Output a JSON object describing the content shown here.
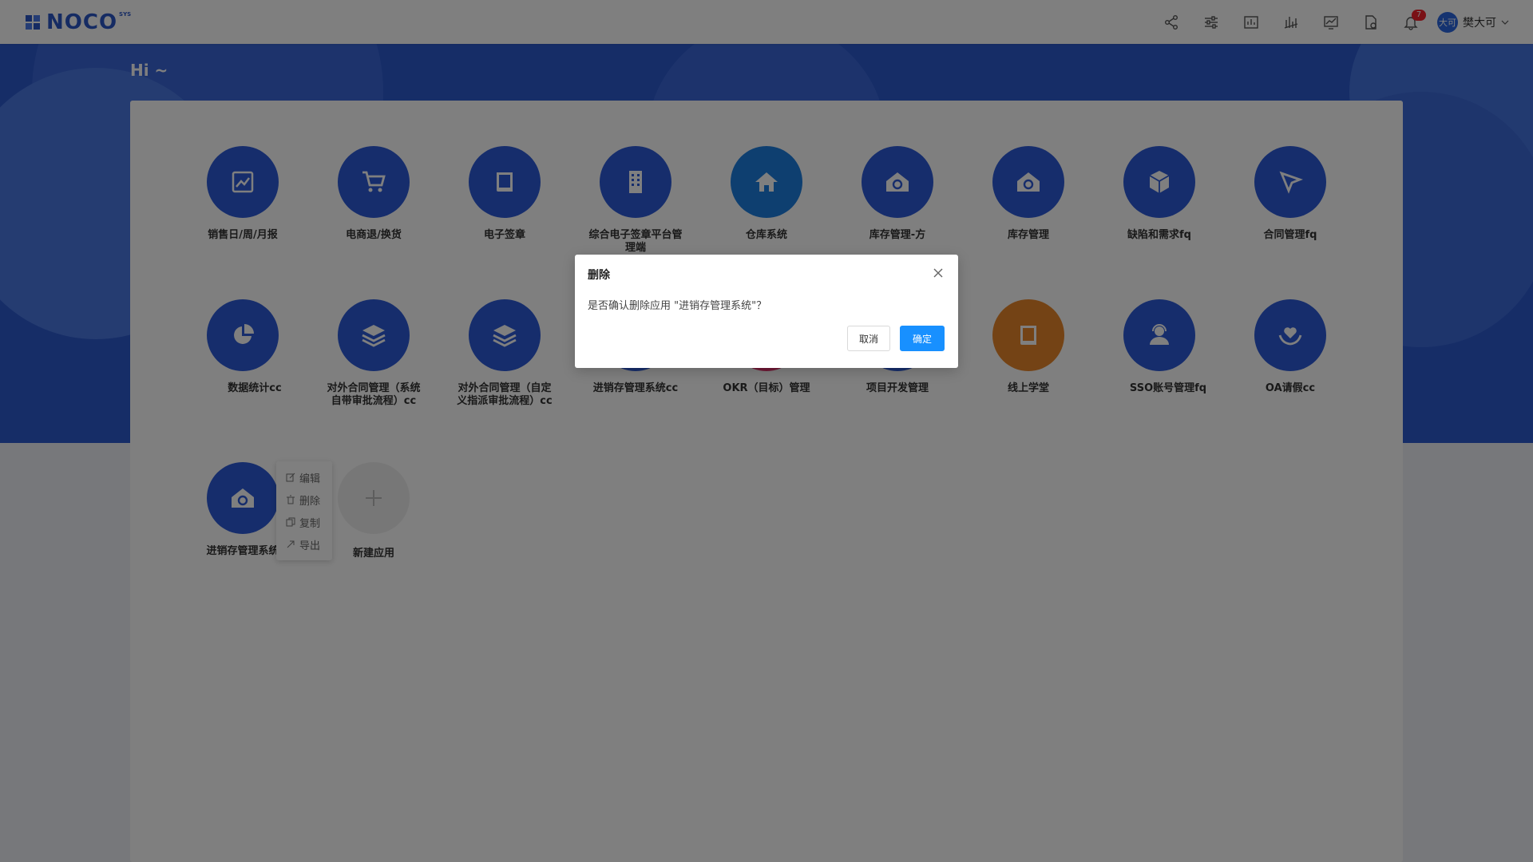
{
  "header": {
    "logo_text": "NOCO",
    "logo_sup": "SYS",
    "notification_count": "7",
    "user_avatar": "大可",
    "user_name": "樊大可",
    "icons": [
      "share-icon",
      "sliders-icon",
      "dashboard-icon",
      "chart-icon",
      "monitor-chart-icon",
      "file-settings-icon",
      "bell-icon",
      "chevron-down-icon"
    ]
  },
  "greeting": "Hi ~",
  "apps": [
    {
      "name": "销售日/周/月报",
      "icon": "line-chart-icon",
      "color": "#2d5bd8"
    },
    {
      "name": "电商退/换货",
      "icon": "cart-icon",
      "color": "#2d5bd8"
    },
    {
      "name": "电子签章",
      "icon": "book-icon",
      "color": "#2d5bd8"
    },
    {
      "name": "综合电子签章平台管理端",
      "icon": "building-icon",
      "color": "#2d5bd8"
    },
    {
      "name": "仓库系统",
      "icon": "home-icon",
      "color": "#1d7fe0"
    },
    {
      "name": "库存管理-方",
      "icon": "home-sync-icon",
      "color": "#2d5bd8"
    },
    {
      "name": "库存管理",
      "icon": "home-sync-icon",
      "color": "#2d5bd8"
    },
    {
      "name": "缺陷和需求fq",
      "icon": "cube-icon",
      "color": "#2d5bd8"
    },
    {
      "name": "合同管理fq",
      "icon": "cursor-icon",
      "color": "#2d5bd8"
    },
    {
      "name": "数据统计cc",
      "icon": "pie-chart-icon",
      "color": "#2d5bd8"
    },
    {
      "name": "对外合同管理（系统自带审批流程）cc",
      "icon": "layers-icon",
      "color": "#2d5bd8"
    },
    {
      "name": "对外合同管理（自定义指派审批流程）cc",
      "icon": "layers-icon",
      "color": "#2d5bd8"
    },
    {
      "name": "进销存管理系统cc",
      "icon": "home-sync-icon",
      "color": "#2d5bd8"
    },
    {
      "name": "OKR（目标）管理",
      "icon": "target-icon",
      "color": "#e0306a"
    },
    {
      "name": "项目开发管理",
      "icon": "project-icon",
      "color": "#2d5bd8"
    },
    {
      "name": "线上学堂",
      "icon": "book-icon",
      "color": "#e8862a"
    },
    {
      "name": "SSO账号管理fq",
      "icon": "user-support-icon",
      "color": "#2d5bd8"
    },
    {
      "name": "OA请假cc",
      "icon": "heart-hand-icon",
      "color": "#2d5bd8"
    },
    {
      "name": "进销存管理系统",
      "icon": "home-sync-icon",
      "color": "#2d5bd8"
    },
    {
      "name": "新建应用",
      "icon": "plus-icon",
      "color": "#eeeeee"
    }
  ],
  "context_menu": {
    "edit": "编辑",
    "delete": "删除",
    "copy": "复制",
    "export": "导出"
  },
  "modal": {
    "title": "删除",
    "message": "是否确认删除应用 \"进销存管理系统\"？",
    "cancel": "取消",
    "confirm": "确定"
  },
  "colors": {
    "brand": "#2b56c7",
    "app_blue": "#2d5bd8",
    "primary_button": "#1890ff",
    "badge": "#f5222d"
  }
}
